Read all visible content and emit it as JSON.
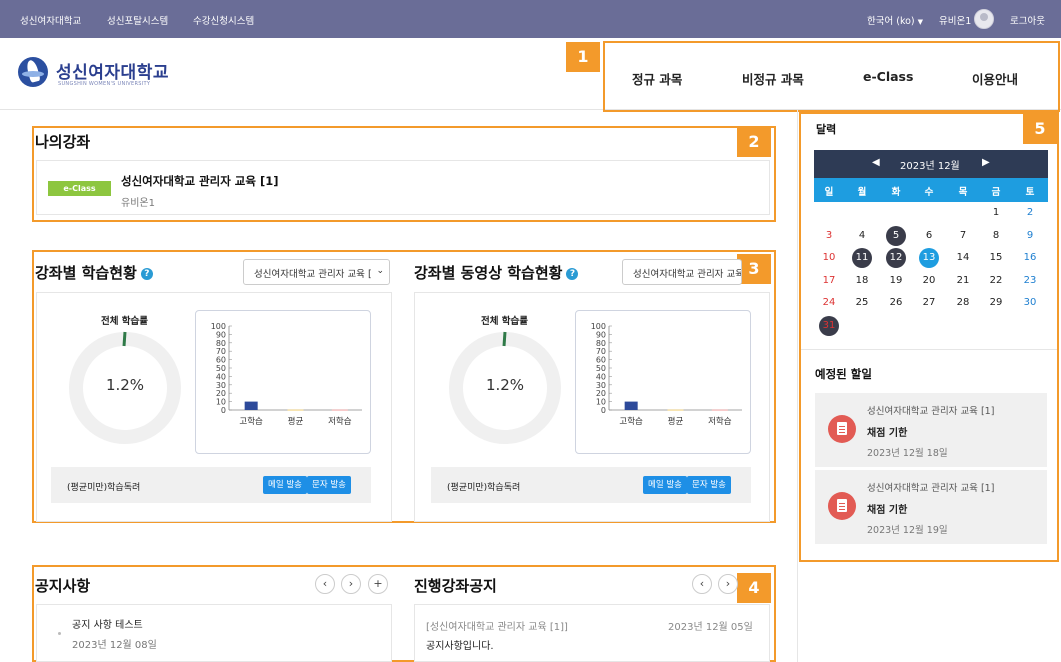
{
  "topbar": {
    "links": [
      "성신여자대학교",
      "성신포탈시스템",
      "수강신청시스템"
    ],
    "language": "한국어 (ko)",
    "user": "유비온1",
    "logout": "로그아웃"
  },
  "header": {
    "logo_text": "성신여자대학교",
    "logo_sub": "SUNGSHIN WOMEN'S UNIVERSITY",
    "nav": [
      "정규 과목",
      "비정규 과목",
      "e-Class",
      "이용안내"
    ]
  },
  "callouts": [
    "1",
    "2",
    "3",
    "4",
    "5"
  ],
  "my_courses": {
    "title": "나의강좌",
    "items": [
      {
        "badge": "e-Class",
        "name": "성신여자대학교 관리자 교육 [1]",
        "professor": "유비온1"
      }
    ]
  },
  "study_status": {
    "title": "강좌별 학습현황",
    "select": "성신여자대학교 관리자 교육 [",
    "donut_title": "전체 학습률",
    "percent": "1.2%",
    "footer_text": "(평균미만)학습독려",
    "mail_btn": "메일 발송",
    "sms_btn": "문자 발송"
  },
  "video_status": {
    "title": "강좌별 동영상 학습현황",
    "select": "성신여자대학교 관리자 교육 [",
    "donut_title": "전체 학습률",
    "percent": "1.2%",
    "footer_text": "(평균미만)학습독려",
    "mail_btn": "메일 발송",
    "sms_btn": "문자 발송"
  },
  "chart_data": [
    {
      "type": "bar",
      "categories": [
        "고학습",
        "평균",
        "저학습"
      ],
      "values": [
        10,
        0.5,
        0.5
      ],
      "colors": [
        "#2d4a9a",
        "#f3d27a",
        "#f2a3a3"
      ],
      "yticks": [
        "100",
        "90",
        "80",
        "70",
        "60",
        "50",
        "40",
        "30",
        "20",
        "10",
        "0"
      ],
      "ylim": [
        0,
        100
      ]
    },
    {
      "type": "bar",
      "categories": [
        "고학습",
        "평균",
        "저학습"
      ],
      "values": [
        10,
        0.5,
        0.5
      ],
      "colors": [
        "#2d4a9a",
        "#f3d27a",
        "#f2a3a3"
      ],
      "yticks": [
        "100",
        "90",
        "80",
        "70",
        "60",
        "50",
        "40",
        "30",
        "20",
        "10",
        "0"
      ],
      "ylim": [
        0,
        100
      ]
    }
  ],
  "notices": {
    "title": "공지사항",
    "items": [
      {
        "title": "공지 사항 테스트",
        "date": "2023년 12월 08일"
      }
    ]
  },
  "course_notices": {
    "title": "진행강좌공지",
    "items": [
      {
        "course": "[성신여자대학교 관리자 교육 [1]]",
        "date": "2023년 12월 05일",
        "text": "공지사항입니다."
      }
    ]
  },
  "calendar": {
    "title": "달력",
    "month": "2023년 12월",
    "weekdays": [
      "일",
      "월",
      "화",
      "수",
      "목",
      "금",
      "토"
    ],
    "rows": [
      [
        "",
        "",
        "",
        "",
        "",
        "1",
        "2"
      ],
      [
        "3",
        "4",
        "5",
        "6",
        "7",
        "8",
        "9"
      ],
      [
        "10",
        "11",
        "12",
        "13",
        "14",
        "15",
        "16"
      ],
      [
        "17",
        "18",
        "19",
        "20",
        "21",
        "22",
        "23"
      ],
      [
        "24",
        "25",
        "26",
        "27",
        "28",
        "29",
        "30"
      ],
      [
        "31",
        "",
        "",
        "",
        "",
        "",
        ""
      ]
    ],
    "highlight_dark": [
      "5",
      "11",
      "12",
      "31"
    ],
    "today": "13"
  },
  "todo": {
    "title": "예정된 할일",
    "items": [
      {
        "course": "성신여자대학교 관리자 교육 [1]",
        "type": "채점 기한",
        "date": "2023년 12월 18일"
      },
      {
        "course": "성신여자대학교 관리자 교육 [1]",
        "type": "채점 기한",
        "date": "2023년 12월 19일"
      }
    ]
  }
}
